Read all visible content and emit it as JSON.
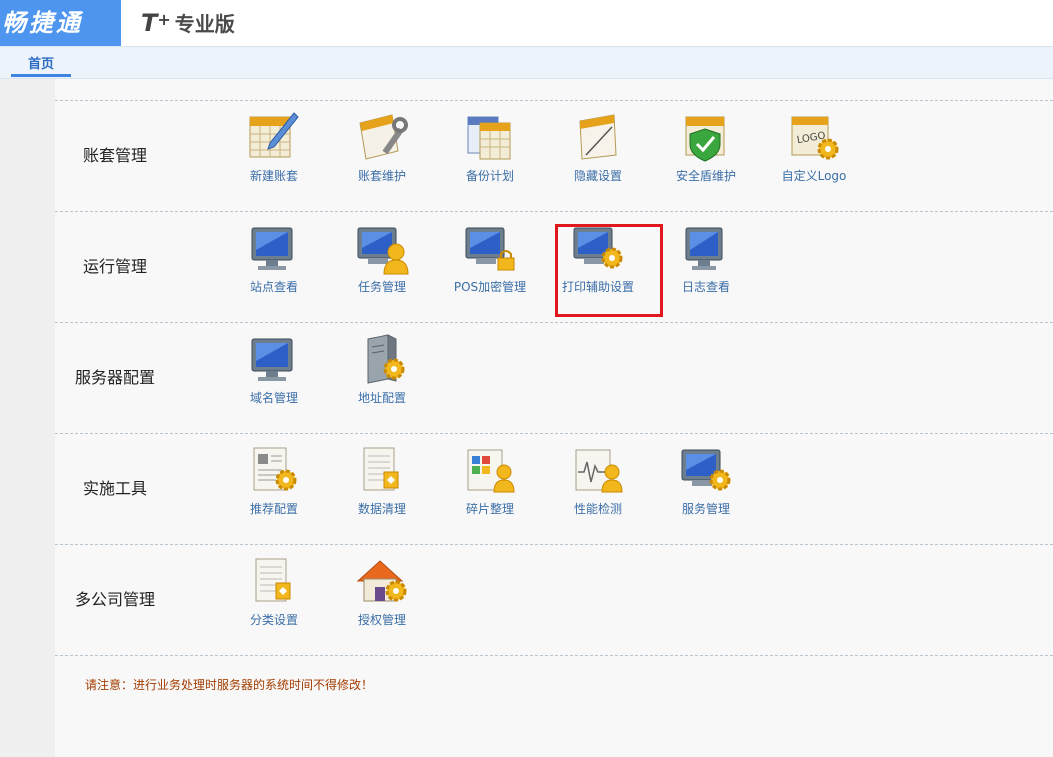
{
  "header": {
    "brand": "畅捷通",
    "product_t": "T",
    "product_plus": "+",
    "product_edition": "专业版"
  },
  "tabs": [
    {
      "label": "首页"
    }
  ],
  "sections": [
    {
      "label": "账套管理",
      "items": [
        {
          "label": "新建账套",
          "icon": "new-account-icon"
        },
        {
          "label": "账套维护",
          "icon": "account-maintain-icon"
        },
        {
          "label": "备份计划",
          "icon": "backup-plan-icon"
        },
        {
          "label": "隐藏设置",
          "icon": "hide-settings-icon"
        },
        {
          "label": "安全盾维护",
          "icon": "security-shield-icon"
        },
        {
          "label": "自定义Logo",
          "icon": "custom-logo-icon"
        }
      ]
    },
    {
      "label": "运行管理",
      "items": [
        {
          "label": "站点查看",
          "icon": "site-view-icon"
        },
        {
          "label": "任务管理",
          "icon": "task-manage-icon"
        },
        {
          "label": "POS加密管理",
          "icon": "pos-encrypt-icon"
        },
        {
          "label": "打印辅助设置",
          "icon": "print-assist-icon"
        },
        {
          "label": "日志查看",
          "icon": "log-view-icon"
        }
      ]
    },
    {
      "label": "服务器配置",
      "items": [
        {
          "label": "域名管理",
          "icon": "domain-manage-icon"
        },
        {
          "label": "地址配置",
          "icon": "address-config-icon"
        }
      ]
    },
    {
      "label": "实施工具",
      "items": [
        {
          "label": "推荐配置",
          "icon": "recommend-config-icon"
        },
        {
          "label": "数据清理",
          "icon": "data-clean-icon"
        },
        {
          "label": "碎片整理",
          "icon": "defrag-icon"
        },
        {
          "label": "性能检测",
          "icon": "performance-icon"
        },
        {
          "label": "服务管理",
          "icon": "service-manage-icon"
        }
      ]
    },
    {
      "label": "多公司管理",
      "items": [
        {
          "label": "分类设置",
          "icon": "category-settings-icon"
        },
        {
          "label": "授权管理",
          "icon": "authorization-icon"
        }
      ]
    }
  ],
  "notice": "请注意：进行业务处理时服务器的系统时间不得修改！",
  "colors": {
    "brand_bg": "#4d95ee",
    "link": "#3b6ea7",
    "highlight": "#e0181e",
    "notice": "#a33c00"
  }
}
